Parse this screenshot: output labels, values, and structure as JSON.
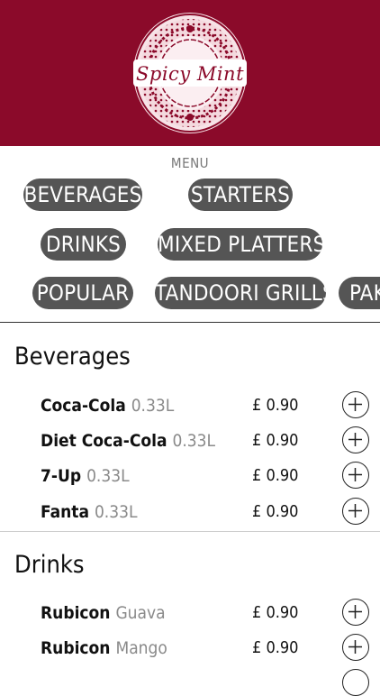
{
  "header": {
    "logo_text": "Spicy Mint",
    "brand_color": "#8b0a2a"
  },
  "menu": {
    "label": "MENU",
    "categories": [
      "BEVERAGES",
      "STARTERS",
      "DRINKS",
      "MIXED PLATTERS",
      "POPULAR",
      "TANDOORI GRILLS",
      "PAK"
    ]
  },
  "sections": [
    {
      "title": "Beverages",
      "items": [
        {
          "name": "Coca-Cola",
          "variant": "0.33L",
          "price": "£ 0.90"
        },
        {
          "name": "Diet Coca-Cola",
          "variant": "0.33L",
          "price": "£ 0.90"
        },
        {
          "name": "7-Up",
          "variant": "0.33L",
          "price": "£ 0.90"
        },
        {
          "name": "Fanta",
          "variant": "0.33L",
          "price": "£ 0.90"
        }
      ]
    },
    {
      "title": "Drinks",
      "items": [
        {
          "name": "Rubicon",
          "variant": "Guava",
          "price": "£ 0.90"
        },
        {
          "name": "Rubicon",
          "variant": "Mango",
          "price": "£ 0.90"
        }
      ]
    }
  ],
  "icons": {
    "add": "plus-circle-icon"
  }
}
